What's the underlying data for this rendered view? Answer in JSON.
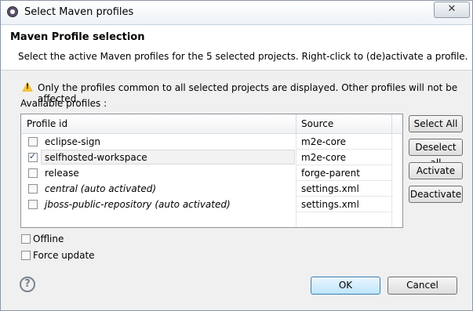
{
  "window": {
    "title": "Select Maven profiles",
    "close_label": "✕"
  },
  "header": {
    "title": "Maven Profile selection",
    "description": "Select the active Maven profiles for the 5 selected projects. Right-click to (de)activate a profile."
  },
  "warning": "Only the profiles common to all selected projects are displayed. Other profiles will not be affected.",
  "available_label": "Available profiles :",
  "table": {
    "columns": [
      "Profile id",
      "Source"
    ],
    "rows": [
      {
        "id": "eclipse-sign",
        "source": "m2e-core",
        "checked": false
      },
      {
        "id": "selfhosted-workspace",
        "source": "m2e-core",
        "checked": true
      },
      {
        "id": "release",
        "source": "forge-parent",
        "checked": false
      },
      {
        "id": "central (auto activated)",
        "source": "settings.xml",
        "checked": false
      },
      {
        "id": "jboss-public-repository (auto activated)",
        "source": "settings.xml",
        "checked": false
      }
    ]
  },
  "side_buttons": [
    "Select All",
    "Deselect all",
    "Activate",
    "Deactivate"
  ],
  "options": [
    {
      "label": "Offline",
      "checked": false
    },
    {
      "label": "Force update",
      "checked": false
    }
  ],
  "footer": {
    "help": "?",
    "ok": "OK",
    "cancel": "Cancel"
  },
  "icons": {
    "app": "maven-icon",
    "warning": "warning-icon",
    "help": "help-icon"
  }
}
